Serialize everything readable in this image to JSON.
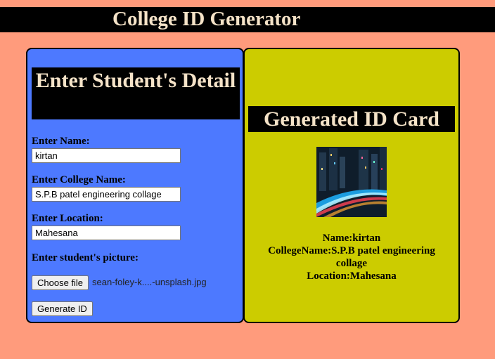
{
  "app": {
    "title": "College ID Generator"
  },
  "form": {
    "header": "Enter Student's Detail",
    "name_label": "Enter Name:",
    "name_value": "kirtan",
    "college_label": "Enter College Name:",
    "college_value": "S.P.B patel engineering collage",
    "location_label": "Enter Location:",
    "location_value": "Mahesana",
    "picture_label": "Enter student's picture:",
    "choose_file_label": "Choose file",
    "file_name": "sean-foley-k....-unsplash.jpg",
    "generate_label": "Generate ID"
  },
  "card": {
    "header": "Generated ID Card",
    "photo_icon": "city-night-photo",
    "name_line": "Name:kirtan",
    "college_line": "CollegeName:S.P.B patel engineering collage",
    "location_line": "Location:Mahesana"
  },
  "colors": {
    "page_background": "#ff9b7c",
    "form_panel": "#4d79ff",
    "card_panel": "#cccc00",
    "header_bar": "#000000",
    "header_text": "#f5e3c8"
  }
}
